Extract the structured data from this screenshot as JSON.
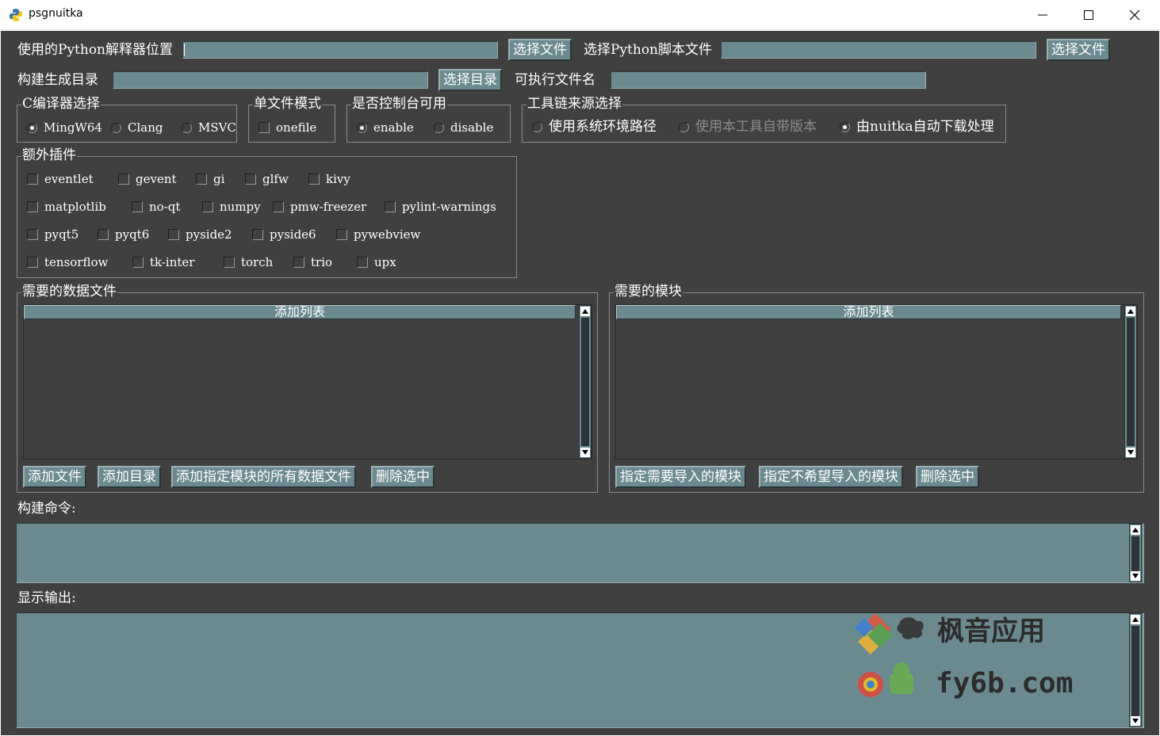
{
  "window": {
    "title": "psgnuitka"
  },
  "row1": {
    "interpreter_label": "使用的Python解释器位置",
    "interpreter_value": "",
    "interpreter_button": "选择文件",
    "script_label": "选择Python脚本文件",
    "script_value": "",
    "script_button": "选择文件"
  },
  "row2": {
    "output_dir_label": "构建生成目录",
    "output_dir_value": "",
    "output_dir_button": "选择目录",
    "exe_name_label": "可执行文件名",
    "exe_name_value": ""
  },
  "c_compiler": {
    "title": "C编译器选择",
    "options": [
      {
        "label": "MingW64",
        "selected": true
      },
      {
        "label": "Clang",
        "selected": false
      },
      {
        "label": "MSVC",
        "selected": false
      }
    ]
  },
  "single_file": {
    "title": "单文件模式",
    "option": {
      "label": "onefile",
      "checked": false
    }
  },
  "console": {
    "title": "是否控制台可用",
    "options": [
      {
        "label": "enable",
        "selected": true
      },
      {
        "label": "disable",
        "selected": false
      }
    ]
  },
  "toolchain": {
    "title": "工具链来源选择",
    "options": [
      {
        "label": "使用系统环境路径",
        "selected": false,
        "disabled": false
      },
      {
        "label": "使用本工具自带版本",
        "selected": false,
        "disabled": true
      },
      {
        "label": "由nuitka自动下载处理",
        "selected": true,
        "disabled": false
      }
    ]
  },
  "plugins": {
    "title": "额外插件",
    "rows": [
      [
        "eventlet",
        "gevent",
        "gi",
        "glfw",
        "kivy"
      ],
      [
        "matplotlib",
        "no-qt",
        "numpy",
        "pmw-freezer",
        "pylint-warnings"
      ],
      [
        "pyqt5",
        "pyqt6",
        "pyside2",
        "pyside6",
        "pywebview"
      ],
      [
        "tensorflow",
        "tk-inter",
        "torch",
        "trio",
        "upx"
      ]
    ]
  },
  "data_files": {
    "title": "需要的数据文件",
    "list_header": "添加列表",
    "buttons": {
      "add_file": "添加文件",
      "add_dir": "添加目录",
      "add_module_data": "添加指定模块的所有数据文件",
      "delete_selected": "删除选中"
    }
  },
  "modules": {
    "title": "需要的模块",
    "list_header": "添加列表",
    "buttons": {
      "include": "指定需要导入的模块",
      "exclude": "指定不希望导入的模块",
      "delete_selected": "删除选中"
    }
  },
  "build_command": {
    "label": "构建命令:",
    "value": ""
  },
  "output": {
    "label": "显示输出:",
    "value": ""
  },
  "watermark": {
    "line1": "枫音应用",
    "line2": "fy6b.com"
  },
  "colors": {
    "background": "#404040",
    "input": "#6b8a90",
    "text": "#ffffff"
  }
}
